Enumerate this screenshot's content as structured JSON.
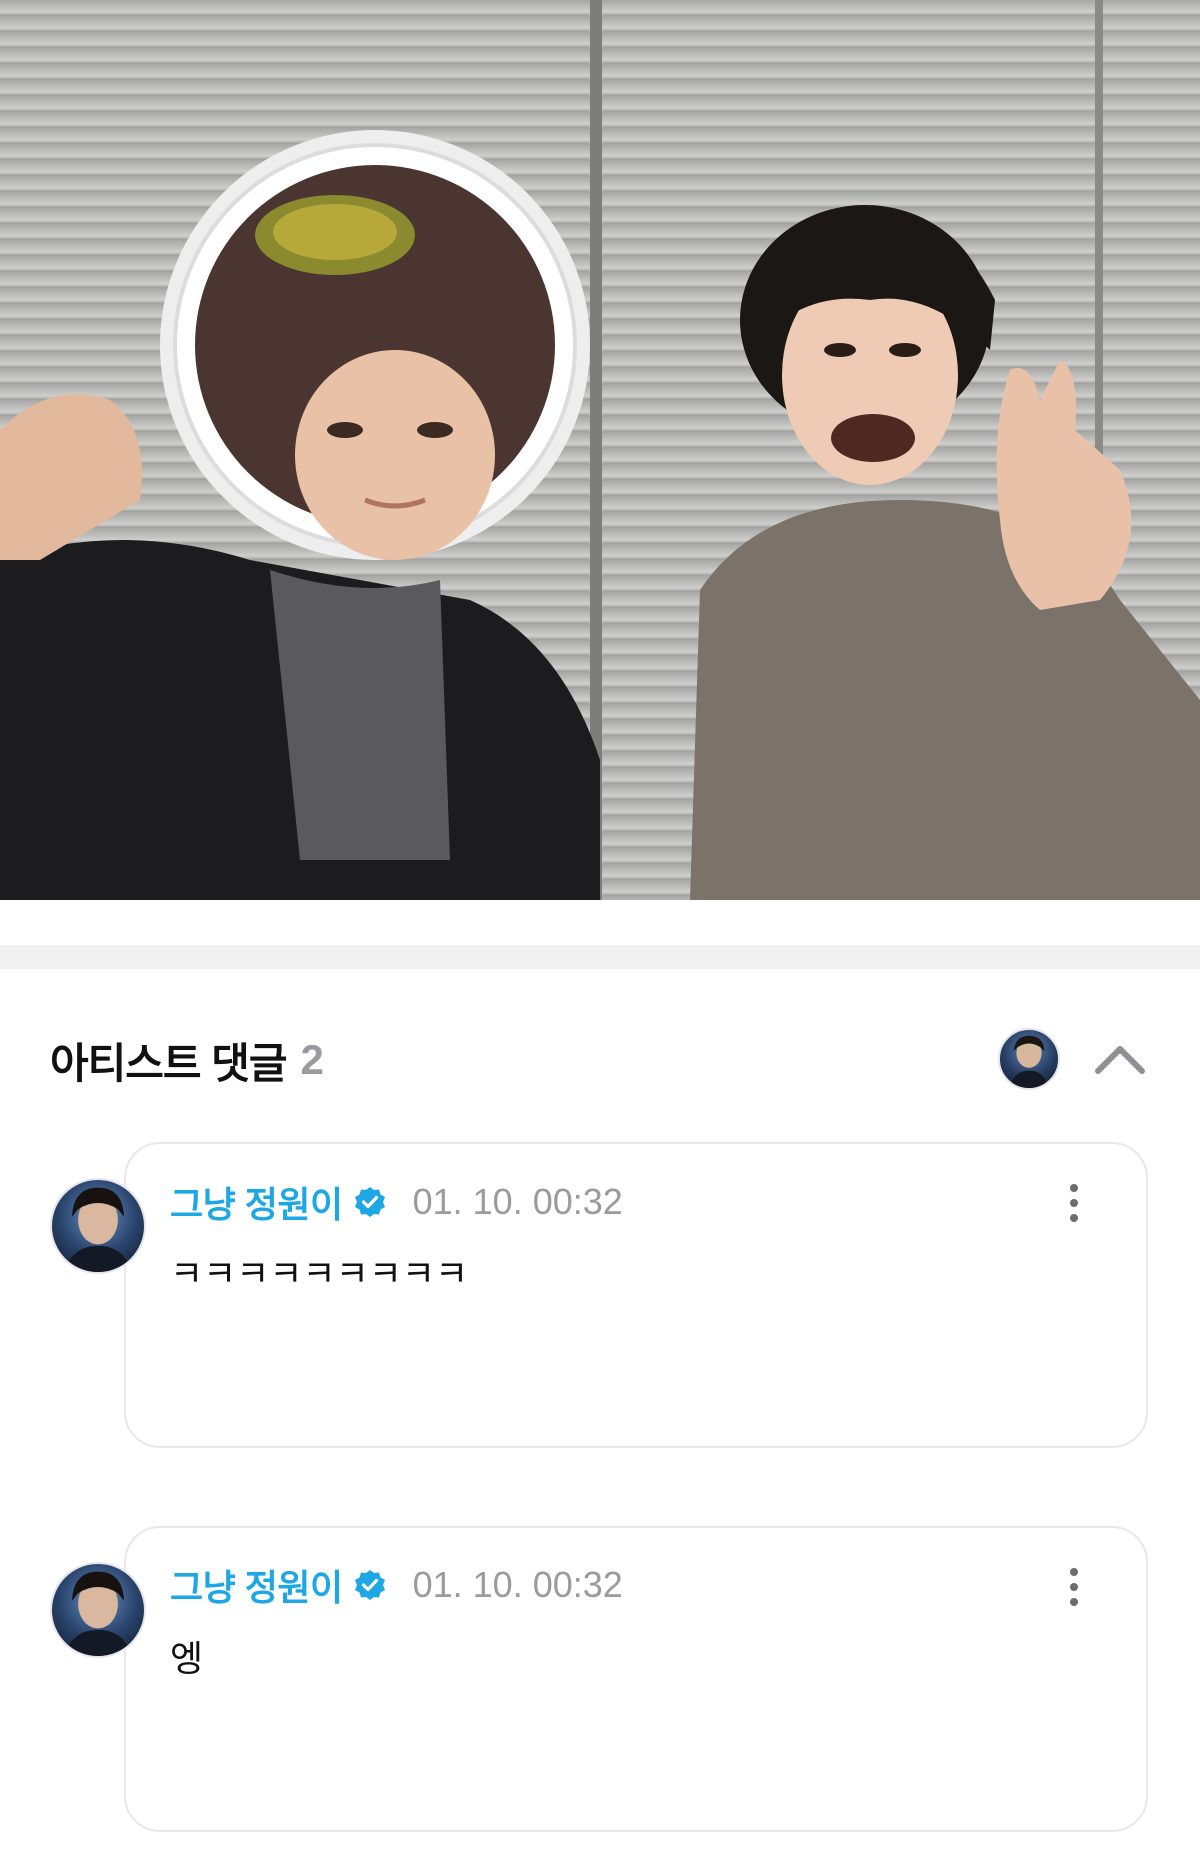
{
  "video": {
    "description_icon": "live-video-frame"
  },
  "section": {
    "title": "아티스트 댓글",
    "count": "2"
  },
  "header": {
    "collapse_icon": "chevron-up-icon"
  },
  "comments": [
    {
      "author": "그냥 정원이",
      "verified": true,
      "timestamp": "01. 10. 00:32",
      "text": "ㅋㅋㅋㅋㅋㅋㅋㅋㅋ"
    },
    {
      "author": "그냥 정원이",
      "verified": true,
      "timestamp": "01. 10. 00:32",
      "text": "엥"
    }
  ],
  "colors": {
    "author": "#1ea7e5",
    "timestamp": "#9a9aa0",
    "count": "#9a9aa0",
    "divider": "#f0f0f1"
  }
}
